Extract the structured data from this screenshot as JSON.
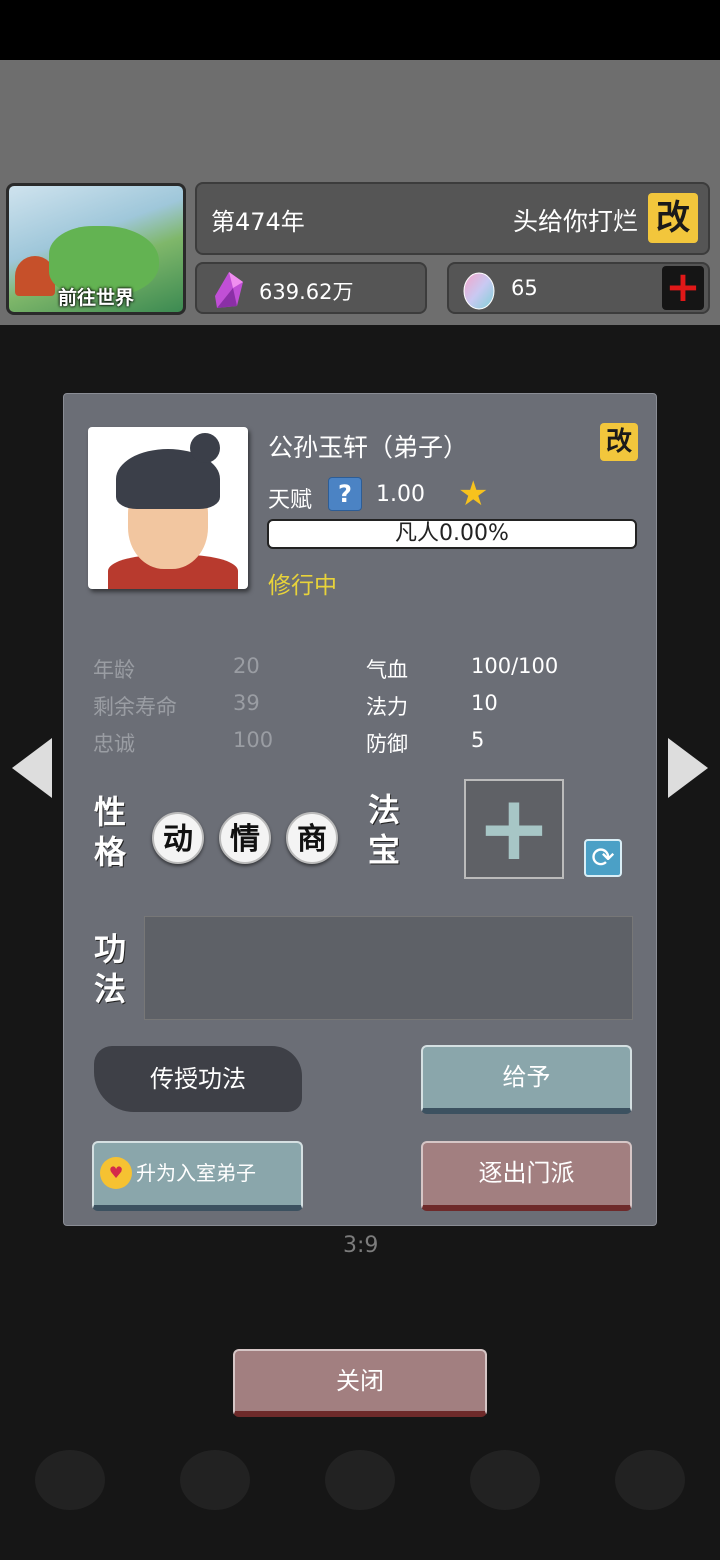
{
  "header": {
    "world_button_label": "前往世界",
    "year": "第474年",
    "sect_name": "头给你打烂",
    "edit_label": "改",
    "spirit_stones": "639.62万",
    "eggs": "65",
    "add_label": "+"
  },
  "dialog": {
    "name": "公孙玉轩（弟子）",
    "edit_label": "改",
    "talent_label": "天赋",
    "talent_help": "?",
    "talent_value": "1.00",
    "star": "★",
    "progress_text": "凡人0.00%",
    "progress_fraction": 0.0,
    "status": "修行中",
    "stats_left": [
      {
        "label": "年龄",
        "value": "20"
      },
      {
        "label": "剩余寿命",
        "value": "39"
      },
      {
        "label": "忠诚",
        "value": "100"
      }
    ],
    "stats_right": [
      {
        "label": "气血",
        "value": "100/100"
      },
      {
        "label": "法力",
        "value": "10"
      },
      {
        "label": "防御",
        "value": "5"
      }
    ],
    "personality_label": [
      "性",
      "格"
    ],
    "traits": [
      "动",
      "情",
      "商"
    ],
    "treasure_label": [
      "法",
      "宝"
    ],
    "treasure_slot": "+",
    "refresh_icon": "⟳",
    "skill_label": [
      "功",
      "法"
    ],
    "teach_button": "传授功法",
    "give_button": "给予",
    "promote_button": "升为入室弟子",
    "promote_emoji": "♥",
    "expel_button": "逐出门派"
  },
  "page_counter": "3:9",
  "close_button": "关闭",
  "colors": {
    "dialog_bg": "#6b6e76",
    "gold_button": "#f2c63c",
    "status_yellow": "#e8d33a",
    "teal_button": "#8aa6ab",
    "rose_button": "#a27f80"
  }
}
